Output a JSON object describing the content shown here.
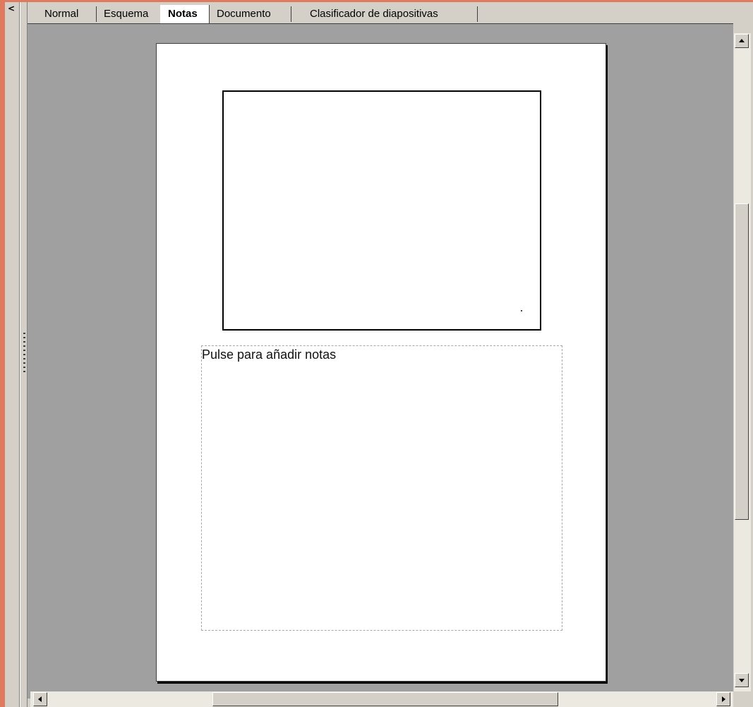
{
  "left_panel": {
    "collapse_label": "<"
  },
  "tabs": [
    {
      "label": "Normal",
      "active": false
    },
    {
      "label": "Esquema",
      "active": false
    },
    {
      "label": "Notas",
      "active": true
    },
    {
      "label": "Documento",
      "active": false
    },
    {
      "label": "Clasificador de diapositivas",
      "active": false
    }
  ],
  "notes_page": {
    "notes_placeholder": "Pulse para añadir notas"
  },
  "colors": {
    "window_border": "#e07a5f",
    "workspace_bg": "#a0a0a0",
    "chrome_bg": "#d4d0c8"
  },
  "icons": {
    "scroll_up": "arrow-up-icon",
    "scroll_down": "arrow-down-icon",
    "scroll_left": "arrow-left-icon",
    "scroll_right": "arrow-right-icon"
  }
}
